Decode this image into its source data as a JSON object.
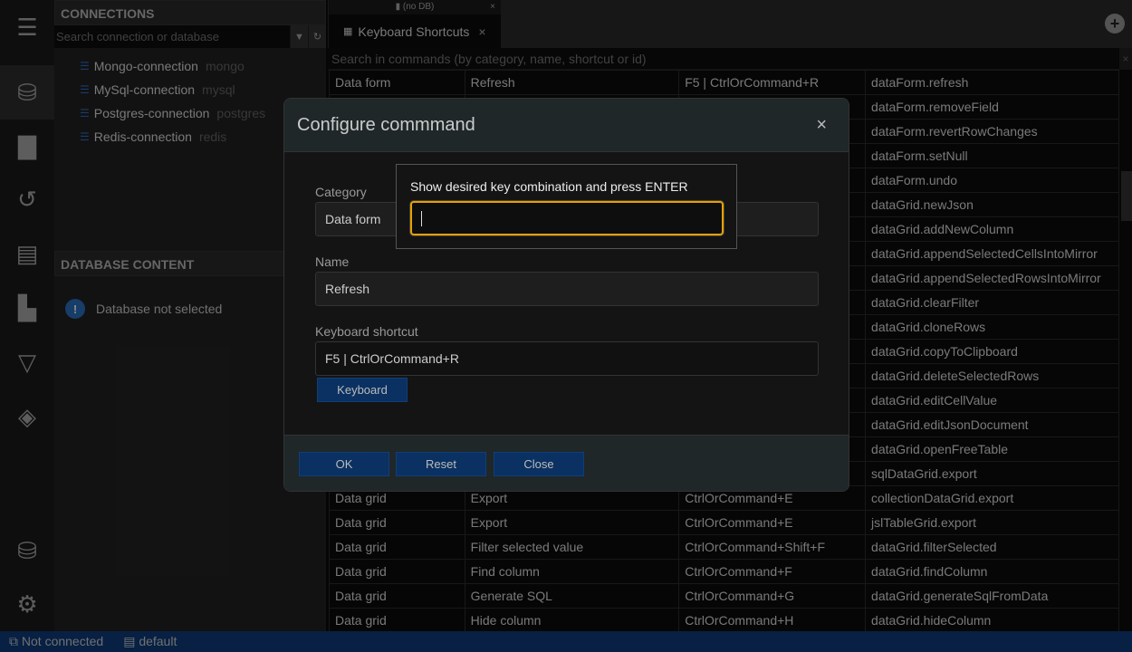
{
  "sidebar": {
    "icons": [
      "menu-icon",
      "database-icon",
      "file-icon",
      "history-icon",
      "archive-icon",
      "plugin-icon",
      "filter-icon",
      "layers-icon",
      "database-eye-icon",
      "gear-icon"
    ]
  },
  "connections": {
    "title": "CONNECTIONS",
    "search_placeholder": "Search connection or database",
    "items": [
      {
        "name": "Mongo-connection",
        "engine": "mongo"
      },
      {
        "name": "MySql-connection",
        "engine": "mysql"
      },
      {
        "name": "Postgres-connection",
        "engine": "postgres"
      },
      {
        "name": "Redis-connection",
        "engine": "redis"
      }
    ]
  },
  "database_content": {
    "title": "DATABASE CONTENT",
    "message": "Database not selected"
  },
  "tabs": {
    "group_label": "(no DB)",
    "active_tab": "Keyboard Shortcuts"
  },
  "commands": {
    "search_placeholder": "Search in commands (by category, name, shortcut or id)",
    "rows": [
      [
        "Data form",
        "Refresh",
        "F5 | CtrlOrCommand+R",
        "dataForm.refresh"
      ],
      [
        "",
        "",
        "",
        "dataForm.removeField"
      ],
      [
        "",
        "",
        "",
        "dataForm.revertRowChanges"
      ],
      [
        "",
        "",
        "",
        "dataForm.setNull"
      ],
      [
        "",
        "",
        "",
        "dataForm.undo"
      ],
      [
        "",
        "",
        "",
        "dataGrid.newJson"
      ],
      [
        "",
        "",
        "",
        "dataGrid.addNewColumn"
      ],
      [
        "",
        "",
        "",
        "dataGrid.appendSelectedCellsIntoMirror"
      ],
      [
        "",
        "",
        "",
        "dataGrid.appendSelectedRowsIntoMirror"
      ],
      [
        "",
        "",
        "",
        "dataGrid.clearFilter"
      ],
      [
        "",
        "",
        "",
        "dataGrid.cloneRows"
      ],
      [
        "",
        "",
        "",
        "dataGrid.copyToClipboard"
      ],
      [
        "",
        "",
        "",
        "dataGrid.deleteSelectedRows"
      ],
      [
        "",
        "",
        "",
        "dataGrid.editCellValue"
      ],
      [
        "",
        "",
        "",
        "dataGrid.editJsonDocument"
      ],
      [
        "",
        "",
        "",
        "dataGrid.openFreeTable"
      ],
      [
        "",
        "",
        "",
        "sqlDataGrid.export"
      ],
      [
        "Data grid",
        "Export",
        "CtrlOrCommand+E",
        "collectionDataGrid.export"
      ],
      [
        "Data grid",
        "Export",
        "CtrlOrCommand+E",
        "jslTableGrid.export"
      ],
      [
        "Data grid",
        "Filter selected value",
        "CtrlOrCommand+Shift+F",
        "dataGrid.filterSelected"
      ],
      [
        "Data grid",
        "Find column",
        "CtrlOrCommand+F",
        "dataGrid.findColumn"
      ],
      [
        "Data grid",
        "Generate SQL",
        "CtrlOrCommand+G",
        "dataGrid.generateSqlFromData"
      ],
      [
        "Data grid",
        "Hide column",
        "CtrlOrCommand+H",
        "dataGrid.hideColumn"
      ]
    ]
  },
  "modal": {
    "title": "Configure commmand",
    "category_label": "Category",
    "category_value": "Data form",
    "name_label": "Name",
    "name_value": "Refresh",
    "shortcut_label": "Keyboard shortcut",
    "shortcut_value": "F5 | CtrlOrCommand+R",
    "keyboard_button": "Keyboard",
    "ok": "OK",
    "reset": "Reset",
    "close": "Close"
  },
  "key_popup": {
    "prompt": "Show desired key combination and press ENTER",
    "value": ""
  },
  "status": {
    "connection": "Not connected",
    "workspace": "default"
  }
}
